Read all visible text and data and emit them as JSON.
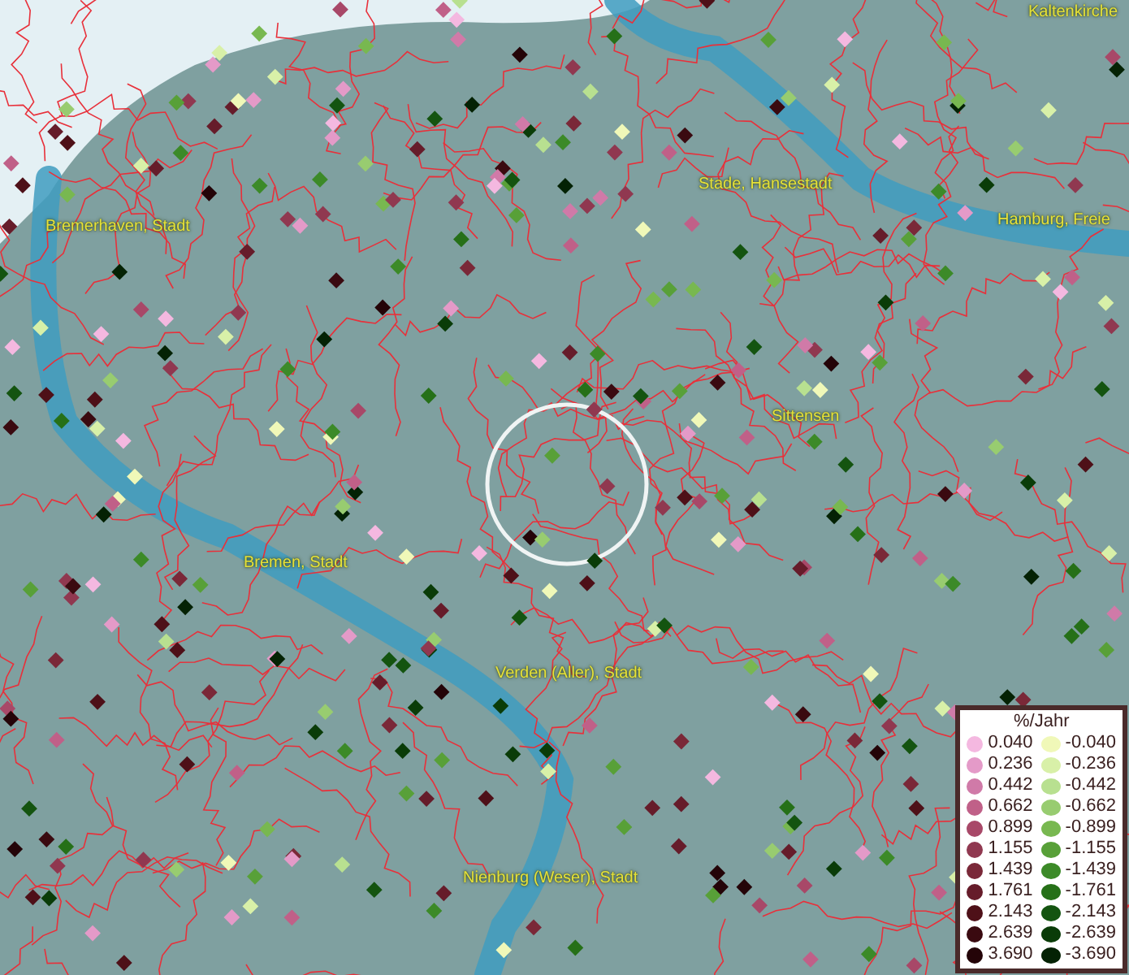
{
  "map": {
    "places": [
      {
        "name": "Kaltenkirche"
      },
      {
        "name": "Stade, Hansestadt"
      },
      {
        "name": "Bremerhaven, Stadt"
      },
      {
        "name": "Hamburg, Freie"
      },
      {
        "name": "Sittensen"
      },
      {
        "name": "Bremen, Stadt"
      },
      {
        "name": "Verden (Aller), Stadt"
      },
      {
        "name": "Nienburg (Weser), Stadt"
      }
    ]
  },
  "legend": {
    "title": "%/Jahr",
    "rows": [
      {
        "positive": {
          "value": "0.040",
          "color": "#f4b8e0"
        },
        "negative": {
          "value": "-0.040",
          "color": "#f0f8b8"
        }
      },
      {
        "positive": {
          "value": "0.236",
          "color": "#e49ac8"
        },
        "negative": {
          "value": "-0.236",
          "color": "#d8f0a8"
        }
      },
      {
        "positive": {
          "value": "0.442",
          "color": "#d07aa8"
        },
        "negative": {
          "value": "-0.442",
          "color": "#b8e090"
        }
      },
      {
        "positive": {
          "value": "0.662",
          "color": "#c06088"
        },
        "negative": {
          "value": "-0.662",
          "color": "#98cc70"
        }
      },
      {
        "positive": {
          "value": "0.899",
          "color": "#a84868"
        },
        "negative": {
          "value": "-0.899",
          "color": "#78b850"
        }
      },
      {
        "positive": {
          "value": "1.155",
          "color": "#903850"
        },
        "negative": {
          "value": "-1.155",
          "color": "#58a038"
        }
      },
      {
        "positive": {
          "value": "1.439",
          "color": "#7a2838"
        },
        "negative": {
          "value": "-1.439",
          "color": "#3c8a28"
        }
      },
      {
        "positive": {
          "value": "1.761",
          "color": "#661c2a"
        },
        "negative": {
          "value": "-1.761",
          "color": "#267018"
        }
      },
      {
        "positive": {
          "value": "2.143",
          "color": "#4e1018"
        },
        "negative": {
          "value": "-2.143",
          "color": "#145410"
        }
      },
      {
        "positive": {
          "value": "2.639",
          "color": "#3a0a10"
        },
        "negative": {
          "value": "-2.639",
          "color": "#0a3c08"
        }
      },
      {
        "positive": {
          "value": "3.690",
          "color": "#240408"
        },
        "negative": {
          "value": "-3.690",
          "color": "#042204"
        }
      }
    ]
  }
}
